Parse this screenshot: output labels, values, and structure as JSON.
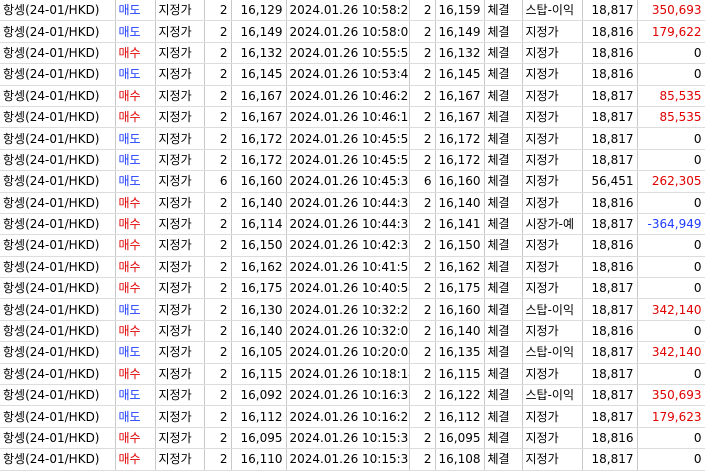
{
  "colors": {
    "sell": "#1e3cff",
    "buy": "#e00000",
    "profit": "#e00000",
    "loss": "#1e3cff"
  },
  "rows": [
    {
      "instrument": "항셍(24-01/HKD)",
      "side": "매도",
      "side_type": "sell",
      "order_type": "지정가",
      "qty": "2",
      "price": "16,129",
      "time": "2024.01.26 10:58:21",
      "fill_qty": "2",
      "fill_price": "16,159",
      "status": "체결",
      "cond": "스탑-이익",
      "margin": "18,817",
      "pl": "350,693",
      "pl_type": "pos"
    },
    {
      "instrument": "항셍(24-01/HKD)",
      "side": "매도",
      "side_type": "sell",
      "order_type": "지정가",
      "qty": "2",
      "price": "16,149",
      "time": "2024.01.26 10:58:03",
      "fill_qty": "2",
      "fill_price": "16,149",
      "status": "체결",
      "cond": "지정가",
      "margin": "18,816",
      "pl": "179,622",
      "pl_type": "pos"
    },
    {
      "instrument": "항셍(24-01/HKD)",
      "side": "매수",
      "side_type": "buy",
      "order_type": "지정가",
      "qty": "2",
      "price": "16,132",
      "time": "2024.01.26 10:55:50",
      "fill_qty": "2",
      "fill_price": "16,132",
      "status": "체결",
      "cond": "지정가",
      "margin": "18,816",
      "pl": "0",
      "pl_type": "zero"
    },
    {
      "instrument": "항셍(24-01/HKD)",
      "side": "매도",
      "side_type": "sell",
      "order_type": "지정가",
      "qty": "2",
      "price": "16,145",
      "time": "2024.01.26 10:53:49",
      "fill_qty": "2",
      "fill_price": "16,145",
      "status": "체결",
      "cond": "지정가",
      "margin": "18,816",
      "pl": "0",
      "pl_type": "zero"
    },
    {
      "instrument": "항셍(24-01/HKD)",
      "side": "매수",
      "side_type": "buy",
      "order_type": "지정가",
      "qty": "2",
      "price": "16,167",
      "time": "2024.01.26 10:46:21",
      "fill_qty": "2",
      "fill_price": "16,167",
      "status": "체결",
      "cond": "지정가",
      "margin": "18,817",
      "pl": "85,535",
      "pl_type": "pos"
    },
    {
      "instrument": "항셍(24-01/HKD)",
      "side": "매수",
      "side_type": "buy",
      "order_type": "지정가",
      "qty": "2",
      "price": "16,167",
      "time": "2024.01.26 10:46:15",
      "fill_qty": "2",
      "fill_price": "16,167",
      "status": "체결",
      "cond": "지정가",
      "margin": "18,817",
      "pl": "85,535",
      "pl_type": "pos"
    },
    {
      "instrument": "항셍(24-01/HKD)",
      "side": "매도",
      "side_type": "sell",
      "order_type": "지정가",
      "qty": "2",
      "price": "16,172",
      "time": "2024.01.26 10:45:50",
      "fill_qty": "2",
      "fill_price": "16,172",
      "status": "체결",
      "cond": "지정가",
      "margin": "18,817",
      "pl": "0",
      "pl_type": "zero"
    },
    {
      "instrument": "항셍(24-01/HKD)",
      "side": "매도",
      "side_type": "sell",
      "order_type": "지정가",
      "qty": "2",
      "price": "16,172",
      "time": "2024.01.26 10:45:50",
      "fill_qty": "2",
      "fill_price": "16,172",
      "status": "체결",
      "cond": "지정가",
      "margin": "18,817",
      "pl": "0",
      "pl_type": "zero"
    },
    {
      "instrument": "항셍(24-01/HKD)",
      "side": "매도",
      "side_type": "sell",
      "order_type": "지정가",
      "qty": "6",
      "price": "16,160",
      "time": "2024.01.26 10:45:30",
      "fill_qty": "6",
      "fill_price": "16,160",
      "status": "체결",
      "cond": "지정가",
      "margin": "56,451",
      "pl": "262,305",
      "pl_type": "pos"
    },
    {
      "instrument": "항셍(24-01/HKD)",
      "side": "매수",
      "side_type": "buy",
      "order_type": "지정가",
      "qty": "2",
      "price": "16,140",
      "time": "2024.01.26 10:44:39",
      "fill_qty": "2",
      "fill_price": "16,140",
      "status": "체결",
      "cond": "지정가",
      "margin": "18,816",
      "pl": "0",
      "pl_type": "zero"
    },
    {
      "instrument": "항셍(24-01/HKD)",
      "side": "매수",
      "side_type": "buy",
      "order_type": "지정가",
      "qty": "2",
      "price": "16,114",
      "time": "2024.01.26 10:44:37",
      "fill_qty": "2",
      "fill_price": "16,141",
      "status": "체결",
      "cond": "시장가-예",
      "margin": "18,817",
      "pl": "-364,949",
      "pl_type": "neg"
    },
    {
      "instrument": "항셍(24-01/HKD)",
      "side": "매수",
      "side_type": "buy",
      "order_type": "지정가",
      "qty": "2",
      "price": "16,150",
      "time": "2024.01.26 10:42:32",
      "fill_qty": "2",
      "fill_price": "16,150",
      "status": "체결",
      "cond": "지정가",
      "margin": "18,816",
      "pl": "0",
      "pl_type": "zero"
    },
    {
      "instrument": "항셍(24-01/HKD)",
      "side": "매수",
      "side_type": "buy",
      "order_type": "지정가",
      "qty": "2",
      "price": "16,162",
      "time": "2024.01.26 10:41:51",
      "fill_qty": "2",
      "fill_price": "16,162",
      "status": "체결",
      "cond": "지정가",
      "margin": "18,816",
      "pl": "0",
      "pl_type": "zero"
    },
    {
      "instrument": "항셍(24-01/HKD)",
      "side": "매수",
      "side_type": "buy",
      "order_type": "지정가",
      "qty": "2",
      "price": "16,175",
      "time": "2024.01.26 10:40:54",
      "fill_qty": "2",
      "fill_price": "16,175",
      "status": "체결",
      "cond": "지정가",
      "margin": "18,817",
      "pl": "0",
      "pl_type": "zero"
    },
    {
      "instrument": "항셍(24-01/HKD)",
      "side": "매도",
      "side_type": "sell",
      "order_type": "지정가",
      "qty": "2",
      "price": "16,130",
      "time": "2024.01.26 10:32:27",
      "fill_qty": "2",
      "fill_price": "16,160",
      "status": "체결",
      "cond": "스탑-이익",
      "margin": "18,817",
      "pl": "342,140",
      "pl_type": "pos"
    },
    {
      "instrument": "항셍(24-01/HKD)",
      "side": "매수",
      "side_type": "buy",
      "order_type": "지정가",
      "qty": "2",
      "price": "16,140",
      "time": "2024.01.26 10:32:02",
      "fill_qty": "2",
      "fill_price": "16,140",
      "status": "체결",
      "cond": "지정가",
      "margin": "18,816",
      "pl": "0",
      "pl_type": "zero"
    },
    {
      "instrument": "항셍(24-01/HKD)",
      "side": "매도",
      "side_type": "sell",
      "order_type": "지정가",
      "qty": "2",
      "price": "16,105",
      "time": "2024.01.26 10:20:04",
      "fill_qty": "2",
      "fill_price": "16,135",
      "status": "체결",
      "cond": "스탑-이익",
      "margin": "18,817",
      "pl": "342,140",
      "pl_type": "pos"
    },
    {
      "instrument": "항셍(24-01/HKD)",
      "side": "매수",
      "side_type": "buy",
      "order_type": "지정가",
      "qty": "2",
      "price": "16,115",
      "time": "2024.01.26 10:18:14",
      "fill_qty": "2",
      "fill_price": "16,115",
      "status": "체결",
      "cond": "지정가",
      "margin": "18,817",
      "pl": "0",
      "pl_type": "zero"
    },
    {
      "instrument": "항셍(24-01/HKD)",
      "side": "매도",
      "side_type": "sell",
      "order_type": "지정가",
      "qty": "2",
      "price": "16,092",
      "time": "2024.01.26 10:16:35",
      "fill_qty": "2",
      "fill_price": "16,122",
      "status": "체결",
      "cond": "스탑-이익",
      "margin": "18,817",
      "pl": "350,693",
      "pl_type": "pos"
    },
    {
      "instrument": "항셍(24-01/HKD)",
      "side": "매도",
      "side_type": "sell",
      "order_type": "지정가",
      "qty": "2",
      "price": "16,112",
      "time": "2024.01.26 10:16:28",
      "fill_qty": "2",
      "fill_price": "16,112",
      "status": "체결",
      "cond": "지정가",
      "margin": "18,817",
      "pl": "179,623",
      "pl_type": "pos"
    },
    {
      "instrument": "항셍(24-01/HKD)",
      "side": "매수",
      "side_type": "buy",
      "order_type": "지정가",
      "qty": "2",
      "price": "16,095",
      "time": "2024.01.26 10:15:39",
      "fill_qty": "2",
      "fill_price": "16,095",
      "status": "체결",
      "cond": "지정가",
      "margin": "18,816",
      "pl": "0",
      "pl_type": "zero"
    },
    {
      "instrument": "항셍(24-01/HKD)",
      "side": "매수",
      "side_type": "buy",
      "order_type": "지정가",
      "qty": "2",
      "price": "16,110",
      "time": "2024.01.26 10:15:35",
      "fill_qty": "2",
      "fill_price": "16,108",
      "status": "체결",
      "cond": "지정가",
      "margin": "18,817",
      "pl": "0",
      "pl_type": "zero"
    }
  ]
}
